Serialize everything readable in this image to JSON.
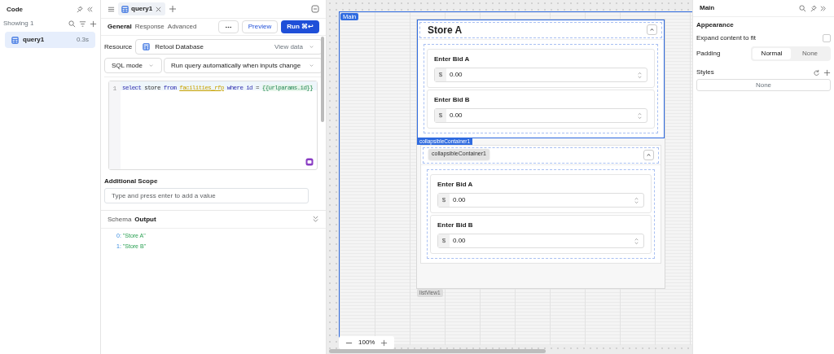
{
  "code_panel": {
    "title": "Code",
    "showing": "Showing 1",
    "queries": [
      {
        "name": "query1",
        "time": "0.3s",
        "selected": true
      }
    ]
  },
  "editor": {
    "tabs": [
      {
        "label": "query1",
        "selected": true
      }
    ],
    "subtabs": [
      {
        "label": "General",
        "selected": true
      },
      {
        "label": "Response",
        "selected": false
      },
      {
        "label": "Advanced",
        "selected": false
      }
    ],
    "preview": "Preview",
    "run": "Run",
    "run_shortcut": "⌘↩",
    "resource_label": "Resource",
    "resource": "Retool Database",
    "view_data": "View data",
    "mode": "SQL mode",
    "trigger": "Run query automatically when inputs change",
    "line_number": "1",
    "sql": [
      {
        "kind": "keyword",
        "text": "select"
      },
      {
        "kind": "plain",
        "text": "store"
      },
      {
        "kind": "keyword",
        "text": "from"
      },
      {
        "kind": "table",
        "text": "facilities_rfp"
      },
      {
        "kind": "keyword",
        "text": "where"
      },
      {
        "kind": "keyword",
        "text": "id"
      },
      {
        "kind": "plain",
        "text": "="
      },
      {
        "kind": "template",
        "text": "{{urlparams.id}}"
      }
    ],
    "scope_label": "Additional Scope",
    "scope_placeholder": "Type and press enter to add a value",
    "output_tabs": [
      {
        "label": "Schema",
        "selected": false
      },
      {
        "label": "Output",
        "selected": true
      }
    ],
    "output": [
      {
        "key": "0:",
        "value": "\"Store A\""
      },
      {
        "key": "1:",
        "value": "\"Store B\""
      }
    ]
  },
  "canvas": {
    "frame_label": "Main",
    "list_label": "listView1",
    "zoom": "100%",
    "items": [
      {
        "title": "Store A",
        "selected": true,
        "tag": "collapsibleContainer1",
        "fields": [
          {
            "label": "Enter Bid A",
            "prefix": "$",
            "value": "0.00"
          },
          {
            "label": "Enter Bid B",
            "prefix": "$",
            "value": "0.00"
          }
        ]
      },
      {
        "selected": false,
        "tooltip": "collapsibleContainer1",
        "fields": [
          {
            "label": "Enter Bid A",
            "prefix": "$",
            "value": "0.00"
          },
          {
            "label": "Enter Bid B",
            "prefix": "$",
            "value": "0.00"
          }
        ]
      }
    ]
  },
  "inspector": {
    "title": "Main",
    "section": "Appearance",
    "expand_label": "Expand content to fit",
    "expand_checked": false,
    "padding_label": "Padding",
    "padding_options": [
      {
        "label": "Normal",
        "selected": true
      },
      {
        "label": "None",
        "selected": false
      }
    ],
    "styles_label": "Styles",
    "styles_value": "None"
  }
}
